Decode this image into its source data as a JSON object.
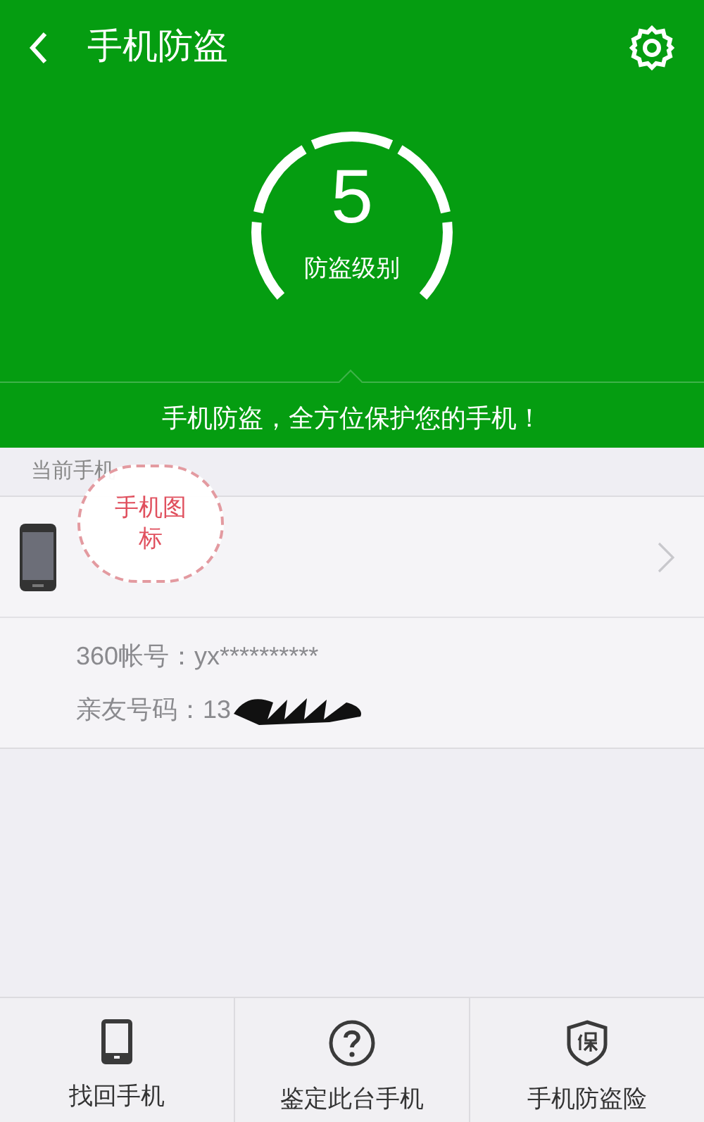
{
  "header": {
    "title": "手机防盗",
    "level_value": "5",
    "level_label": "防盗级别",
    "tagline": "手机防盗，全方位保护您的手机！"
  },
  "section_label": "当前手机",
  "annotation": "手机图标",
  "info": [
    {
      "label": "360帐号：",
      "value": "yx**********",
      "redacted": false
    },
    {
      "label": "亲友号码：",
      "value": "13",
      "redacted": true
    }
  ],
  "bottom_nav": [
    {
      "kind": "phone",
      "label": "找回手机"
    },
    {
      "kind": "question",
      "label": "鉴定此台手机"
    },
    {
      "kind": "shield",
      "label": "手机防盗险"
    }
  ]
}
